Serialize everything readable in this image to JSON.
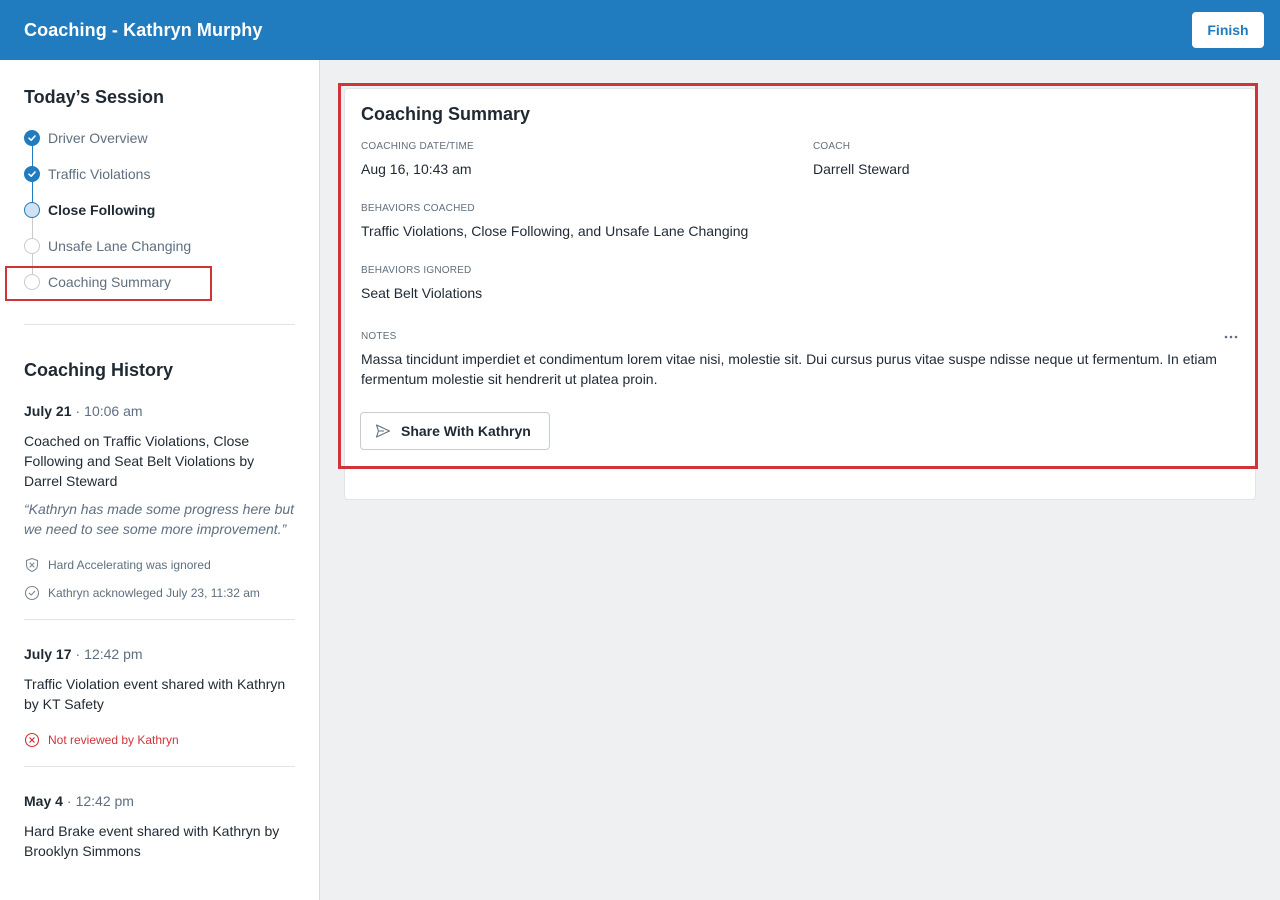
{
  "header": {
    "title": "Coaching - Kathryn Murphy",
    "finish_label": "Finish"
  },
  "session": {
    "title": "Today’s Session",
    "steps": [
      {
        "label": "Driver Overview",
        "state": "done"
      },
      {
        "label": "Traffic Violations",
        "state": "done"
      },
      {
        "label": "Close Following",
        "state": "current"
      },
      {
        "label": "Unsafe Lane Changing",
        "state": "todo"
      },
      {
        "label": "Coaching Summary",
        "state": "todo"
      }
    ]
  },
  "history": {
    "title": "Coaching History",
    "entries": [
      {
        "date": "July 21",
        "time": "10:06 am",
        "text": "Coached on Traffic Violations, Close Following and Seat Belt Violations by Darrel Steward",
        "quote": "“Kathryn has made some progress here but we need to see some more improvement.”",
        "meta": [
          {
            "icon": "shield-x-icon",
            "text": "Hard Accelerating was ignored"
          },
          {
            "icon": "check-circle-icon",
            "text": "Kathryn acknowleged July 23, 11:32 am"
          }
        ]
      },
      {
        "date": "July 17",
        "time": "12:42 pm",
        "text": "Traffic Violation event shared with Kathryn by KT Safety",
        "meta": [
          {
            "icon": "x-circle-icon",
            "text": "Not reviewed by Kathryn"
          }
        ]
      },
      {
        "date": "May 4",
        "time": "12:42 pm",
        "text": "Hard Brake event shared with Kathryn by Brooklyn Simmons"
      }
    ]
  },
  "summary": {
    "title": "Coaching Summary",
    "date_label": "COACHING DATE/TIME",
    "date_value": "Aug 16, 10:43 am",
    "coach_label": "COACH",
    "coach_value": "Darrell Steward",
    "coached_label": "BEHAVIORS COACHED",
    "coached_value": "Traffic Violations, Close Following, and Unsafe Lane Changing",
    "ignored_label": "BEHAVIORS IGNORED",
    "ignored_value": "Seat Belt Violations",
    "notes_label": "NOTES",
    "notes_value": "Massa tincidunt imperdiet et condimentum lorem vitae nisi, molestie sit. Dui cursus purus vitae suspe ndisse neque ut fermentum. In etiam fermentum molestie sit hendrerit ut platea proin.",
    "share_label": "Share With Kathryn"
  },
  "colors": {
    "brand": "#217bbf",
    "highlight": "#d13438",
    "error": "#d13438"
  }
}
